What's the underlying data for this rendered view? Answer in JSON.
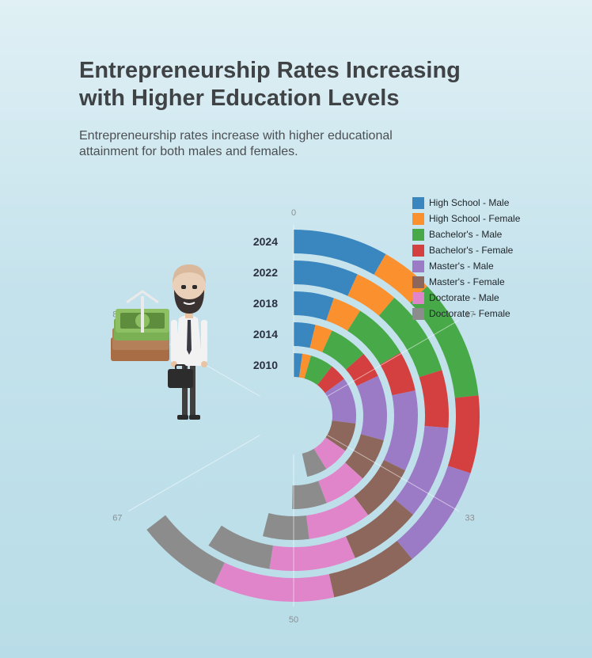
{
  "header": {
    "title": "Entrepreneurship Rates Increasing with Higher Education Levels",
    "subtitle": "Entrepreneurship rates increase with higher educational attainment for both males and females."
  },
  "chart_data": {
    "type": "radial-stacked-bar",
    "title": "Entrepreneurship Rates Increasing with Higher Education Levels",
    "categories": [
      "2024",
      "2022",
      "2018",
      "2014",
      "2010"
    ],
    "axis_max": 100,
    "axis_ticks": [
      "0",
      "17",
      "33",
      "50",
      "67",
      "83"
    ],
    "series": [
      {
        "name": "High School - Male",
        "color": "#3a87c0",
        "values": [
          11,
          9,
          7,
          5,
          3
        ]
      },
      {
        "name": "High School - Female",
        "color": "#fb902e",
        "values": [
          6,
          6,
          5,
          4,
          3
        ]
      },
      {
        "name": "Bachelor's - Male",
        "color": "#48a949",
        "values": [
          14,
          12,
          10,
          9,
          8
        ]
      },
      {
        "name": "Bachelor's - Female",
        "color": "#d43f3f",
        "values": [
          9,
          8,
          7,
          6,
          6
        ]
      },
      {
        "name": "Master's - Male",
        "color": "#9b7ac6",
        "values": [
          12,
          13,
          14,
          15,
          16
        ]
      },
      {
        "name": "Master's - Female",
        "color": "#8d675c",
        "values": [
          10,
          10,
          10,
          10,
          10
        ]
      },
      {
        "name": "Doctorate - Male",
        "color": "#e085c9",
        "values": [
          14,
          12,
          11,
          10,
          9
        ]
      },
      {
        "name": "Doctorate - Female",
        "color": "#8c8c8c",
        "values": [
          10,
          9,
          8,
          8,
          7
        ]
      }
    ]
  }
}
